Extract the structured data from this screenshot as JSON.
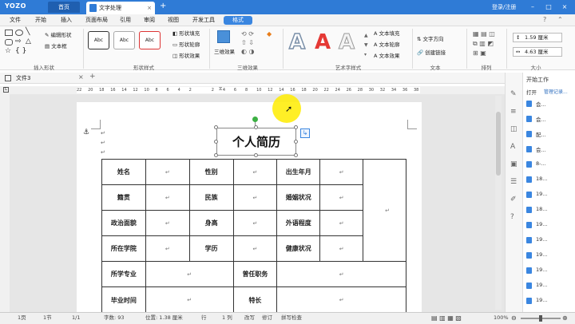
{
  "app": {
    "logo": "YOZO",
    "home_tab": "首页",
    "doc_tab": "文字处理",
    "login": "登录/注册"
  },
  "menu": [
    "文件",
    "开始",
    "插入",
    "页面布局",
    "引用",
    "审阅",
    "视图",
    "开发工具",
    "格式"
  ],
  "ribbon": {
    "insert_shape": {
      "label": "插入形状",
      "edit_shape": "编辑形状",
      "text_box": "文本框"
    },
    "shape_styles": {
      "label": "形状样式",
      "styles": [
        "Abc",
        "Abc",
        "Abc"
      ],
      "fill": "形状填充",
      "outline": "形状轮廓",
      "effect": "形状效果"
    },
    "effects_3d": {
      "label": "三维效果",
      "button": "三维效果"
    },
    "art_styles": {
      "label": "艺术字样式",
      "letter": "A",
      "fill": "文本填充",
      "outline": "文本轮廓",
      "effect": "文本效果"
    },
    "text": {
      "label": "文本",
      "direction": "文字方向",
      "link": "创建链接"
    },
    "arrange": {
      "label": "排列"
    },
    "size": {
      "label": "大小",
      "height": "1.59 厘米",
      "width": "4.63 厘米"
    }
  },
  "doc": {
    "tab_name": "文件3",
    "title": "个人简历",
    "para_mark": "↵",
    "anchor": "⚓"
  },
  "ruler": [
    "22",
    "20",
    "18",
    "16",
    "14",
    "12",
    "10",
    "8",
    "6",
    "4",
    "2",
    "",
    "2",
    "4",
    "6",
    "8",
    "10",
    "12",
    "14",
    "16",
    "18",
    "20",
    "22",
    "24",
    "26",
    "28",
    "30",
    "32",
    "34",
    "36",
    "38"
  ],
  "table": {
    "rows": [
      [
        "姓名",
        "↵",
        "性别",
        "↵",
        "出生年月",
        "↵"
      ],
      [
        "籍贯",
        "↵",
        "民族",
        "↵",
        "婚姻状况",
        "↵"
      ],
      [
        "政治面貌",
        "↵",
        "身高",
        "↵",
        "外语程度",
        "↵"
      ],
      [
        "所在学院",
        "↵",
        "学历",
        "↵",
        "健康状况",
        "↵"
      ]
    ],
    "photo_mark": "↵",
    "row5": [
      "所学专业",
      "↵",
      "曾任职务",
      "↵"
    ],
    "row6": [
      "毕业时间",
      "↵",
      "特长",
      "↵"
    ]
  },
  "panel": {
    "title": "开始工作",
    "open": "打开",
    "manage": "管理记录...",
    "items": [
      "会...",
      "会...",
      "配...",
      "会...",
      "8-...",
      "18...",
      "19...",
      "18...",
      "19...",
      "19...",
      "19...",
      "19...",
      "19...",
      "19..."
    ]
  },
  "status": {
    "page": "1页",
    "section": "1节",
    "pages": "1/1",
    "words": "字数: 93",
    "position": "位置: 1.38 厘米",
    "line": "行",
    "col": "1 列",
    "mode1": "改写",
    "mode2": "修订",
    "spell": "拼写检查",
    "zoom": "100%"
  }
}
